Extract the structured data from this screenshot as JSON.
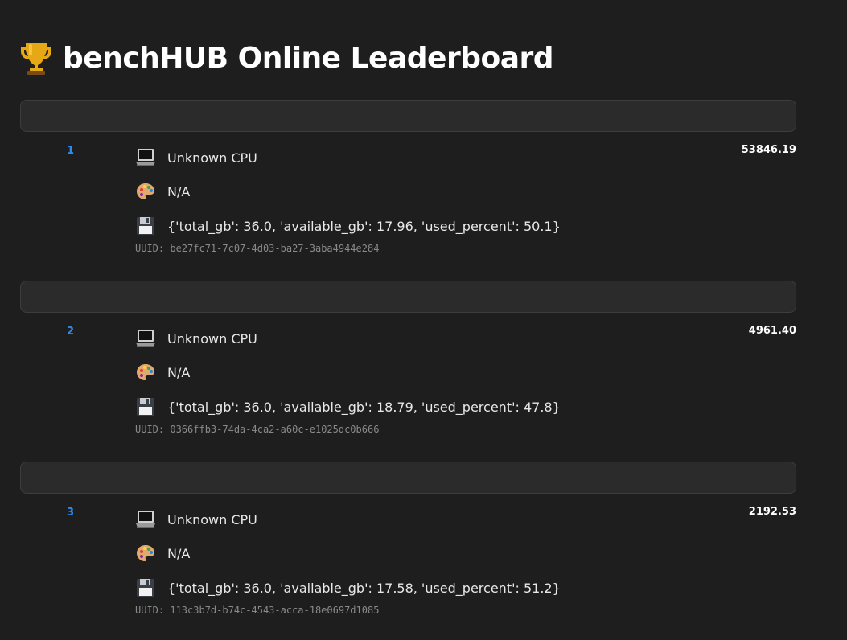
{
  "header": {
    "title": "benchHUB Online Leaderboard",
    "icon": "trophy-icon"
  },
  "colors": {
    "background": "#1e1e1e",
    "rank": "#2e8bf0",
    "uuid": "#8a8a8a"
  },
  "entries": [
    {
      "rank": "1",
      "score": "53846.19",
      "cpu": "Unknown CPU",
      "gpu": "N/A",
      "memory": "{'total_gb': 36.0, 'available_gb': 17.96, 'used_percent': 50.1}",
      "uuid": "UUID: be27fc71-7c07-4d03-ba27-3aba4944e284"
    },
    {
      "rank": "2",
      "score": "4961.40",
      "cpu": "Unknown CPU",
      "gpu": "N/A",
      "memory": "{'total_gb': 36.0, 'available_gb': 18.79, 'used_percent': 47.8}",
      "uuid": "UUID: 0366ffb3-74da-4ca2-a60c-e1025dc0b666"
    },
    {
      "rank": "3",
      "score": "2192.53",
      "cpu": "Unknown CPU",
      "gpu": "N/A",
      "memory": "{'total_gb': 36.0, 'available_gb': 17.58, 'used_percent': 51.2}",
      "uuid": "UUID: 113c3b7d-b74c-4543-acca-18e0697d1085"
    }
  ]
}
